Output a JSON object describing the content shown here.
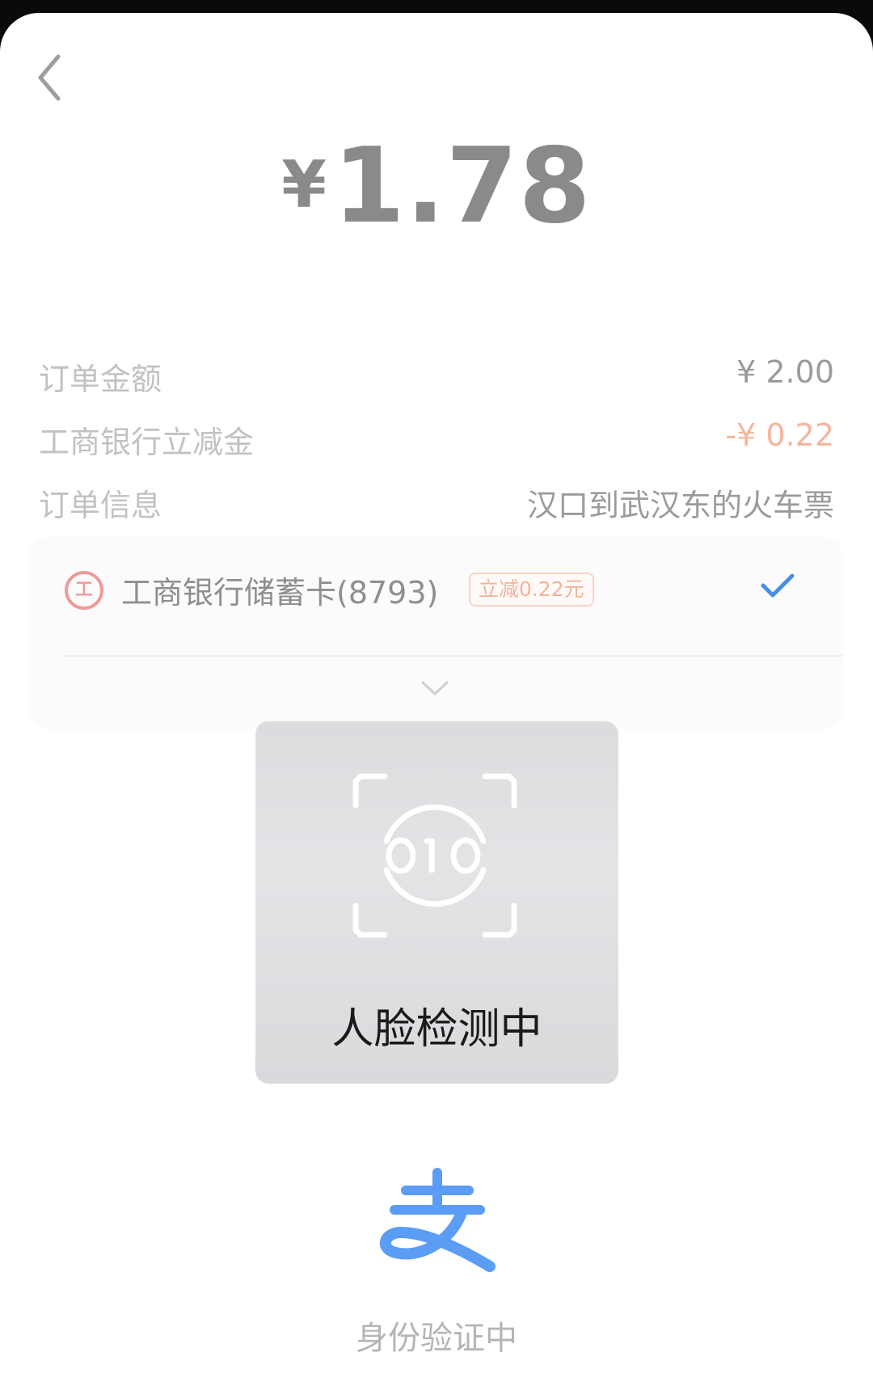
{
  "payment": {
    "currency_symbol": "¥",
    "amount": "1.78"
  },
  "details": {
    "order_amount_label": "订单金额",
    "order_amount_value": "¥ 2.00",
    "discount_label": "工商银行立减金",
    "discount_value": "-¥ 0.22",
    "order_info_label": "订单信息",
    "order_info_value": "汉口到武汉东的火车票"
  },
  "payment_method": {
    "bank_logo_glyph": "工",
    "card_name": "工商银行储蓄卡(8793)",
    "promo_badge": "立减0.22元",
    "selected": true
  },
  "face_verification": {
    "status_text": "人脸检测中"
  },
  "footer": {
    "status_text": "身份验证中"
  },
  "colors": {
    "amount": "#8a8a8a",
    "discount": "#f6b59e",
    "check": "#4a90e2",
    "alipay_blue": "#5b9cf5"
  },
  "icons": [
    "back-chevron-icon",
    "icbc-logo-icon",
    "checkmark-icon",
    "chevron-down-icon",
    "face-scan-icon",
    "alipay-logo-icon"
  ]
}
